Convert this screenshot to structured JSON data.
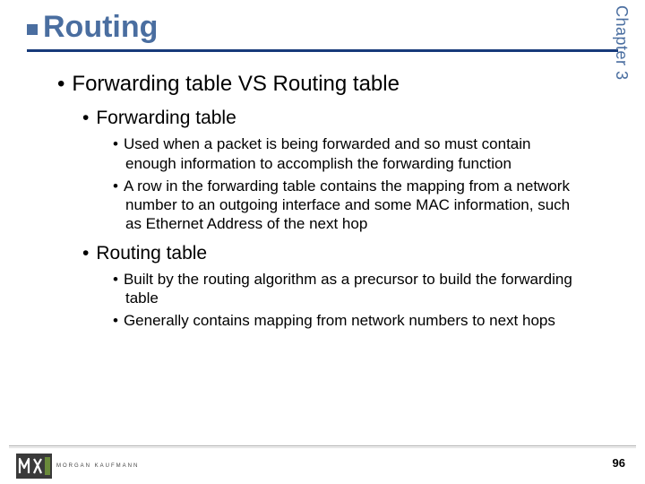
{
  "chapter": "Chapter 3",
  "title": "Routing",
  "content": {
    "lvl1": "Forwarding table VS Routing table",
    "sections": [
      {
        "heading": "Forwarding table",
        "points": [
          "Used when a packet is being forwarded and so must contain enough information to accomplish the forwarding function",
          "A row in the forwarding table contains the mapping from a network number to an outgoing interface and some MAC information, such as Ethernet Address of the next hop"
        ]
      },
      {
        "heading": "Routing table",
        "points": [
          "Built by the routing algorithm as a precursor to build the forwarding table",
          "Generally contains mapping from network numbers to next hops"
        ]
      }
    ]
  },
  "publisher_text": "MORGAN KAUFMANN",
  "page_number": "96"
}
